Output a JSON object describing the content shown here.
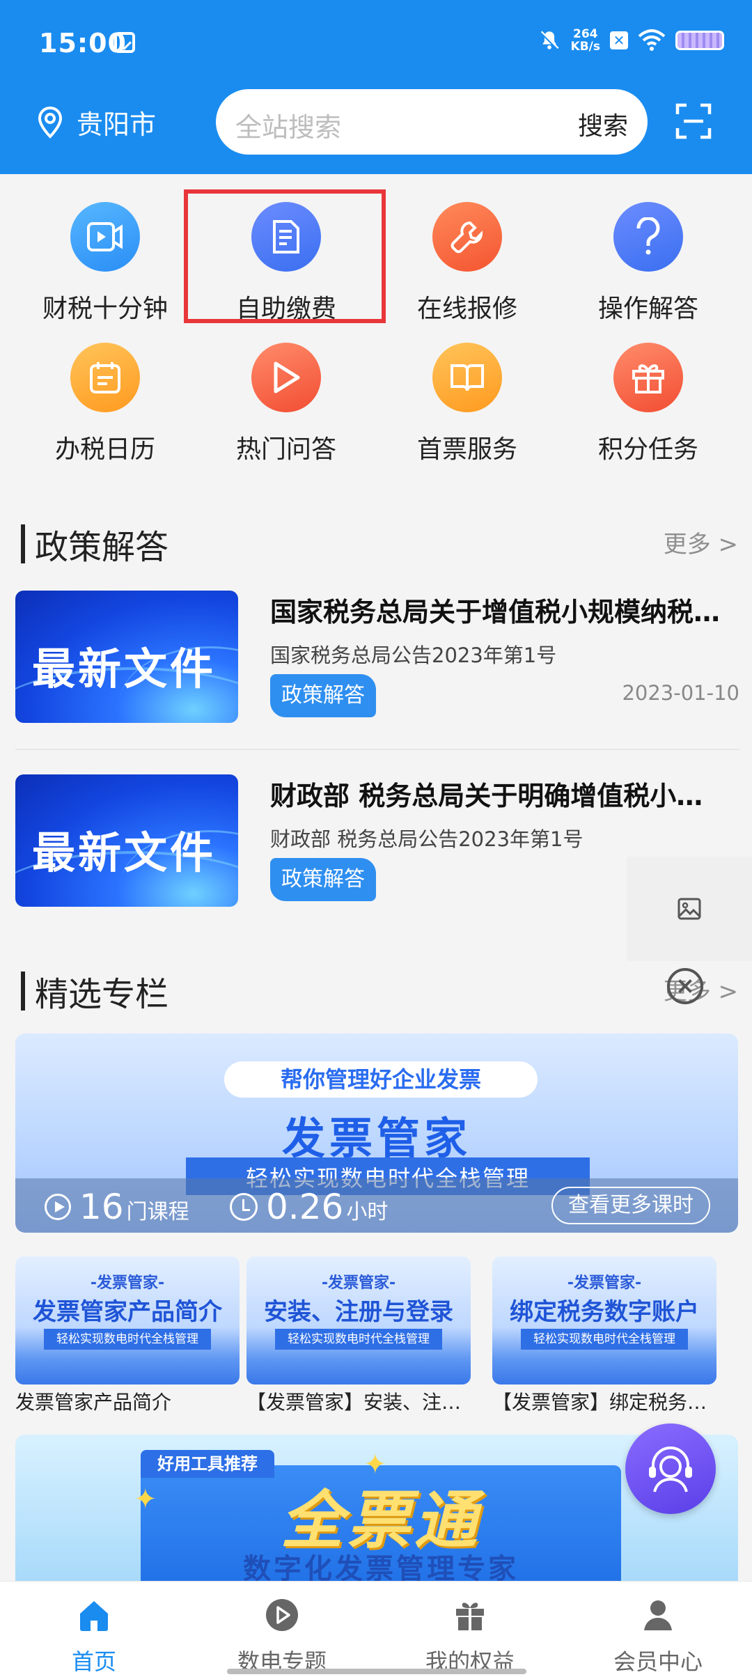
{
  "status": {
    "time": "15:00",
    "speed_value": "264",
    "speed_unit": "KB/s"
  },
  "header": {
    "city": "贵阳市",
    "search_placeholder": "全站搜索",
    "search_button": "搜索"
  },
  "grid": [
    {
      "label": "财税十分钟",
      "icon": "video-icon"
    },
    {
      "label": "自助缴费",
      "icon": "document-icon"
    },
    {
      "label": "在线报修",
      "icon": "wrench-icon"
    },
    {
      "label": "操作解答",
      "icon": "question-icon"
    },
    {
      "label": "办税日历",
      "icon": "calendar-icon"
    },
    {
      "label": "热门问答",
      "icon": "play-icon"
    },
    {
      "label": "首票服务",
      "icon": "book-icon"
    },
    {
      "label": "积分任务",
      "icon": "gift-icon"
    }
  ],
  "policy": {
    "title": "政策解答",
    "more": "更多 >",
    "items": [
      {
        "img_text": "最新文件",
        "title": "国家税务总局关于增值税小规模纳税人…",
        "sub": "国家税务总局公告2023年第1号",
        "tag": "政策解答",
        "date": "2023-01-10"
      },
      {
        "img_text": "最新文件",
        "title": "财政部 税务总局关于明确增值税小…",
        "sub": "财政部 税务总局公告2023年第1号",
        "tag": "政策解答",
        "date": ""
      }
    ]
  },
  "featured": {
    "title": "精选专栏",
    "more": "更多 >",
    "banner": {
      "pill": "帮你管理好企业发票",
      "title": "发票管家",
      "strip": "轻松实现数电时代全栈管理",
      "courses_num": "16",
      "courses_unit": "门课程",
      "hours_num": "0.26",
      "hours_unit": "小时",
      "button": "查看更多课时"
    },
    "cards": [
      {
        "top": "-发票管家-",
        "title": "发票管家产品简介",
        "strip": "轻松实现数电时代全栈管理",
        "caption": "发票管家产品简介"
      },
      {
        "top": "-发票管家-",
        "title": "安装、注册与登录",
        "strip": "轻松实现数电时代全栈管理",
        "caption": "【发票管家】安装、注…"
      },
      {
        "top": "-发票管家-",
        "title": "绑定税务数字账户",
        "strip": "轻松实现数电时代全栈管理",
        "caption": "【发票管家】绑定税务…"
      }
    ]
  },
  "promo": {
    "tag": "好用工具推荐",
    "title": "全票通",
    "subtitle": "数字化发票管理专家"
  },
  "nav": [
    {
      "label": "首页",
      "icon": "home-icon",
      "active": true
    },
    {
      "label": "数电专题",
      "icon": "play-circle-icon",
      "active": false
    },
    {
      "label": "我的权益",
      "icon": "gift-icon",
      "active": false
    },
    {
      "label": "会员中心",
      "icon": "user-icon",
      "active": false
    }
  ],
  "colors": {
    "primary": "#1a8cf0",
    "highlight": "#e8363a",
    "tag": "#2f8ff0"
  }
}
